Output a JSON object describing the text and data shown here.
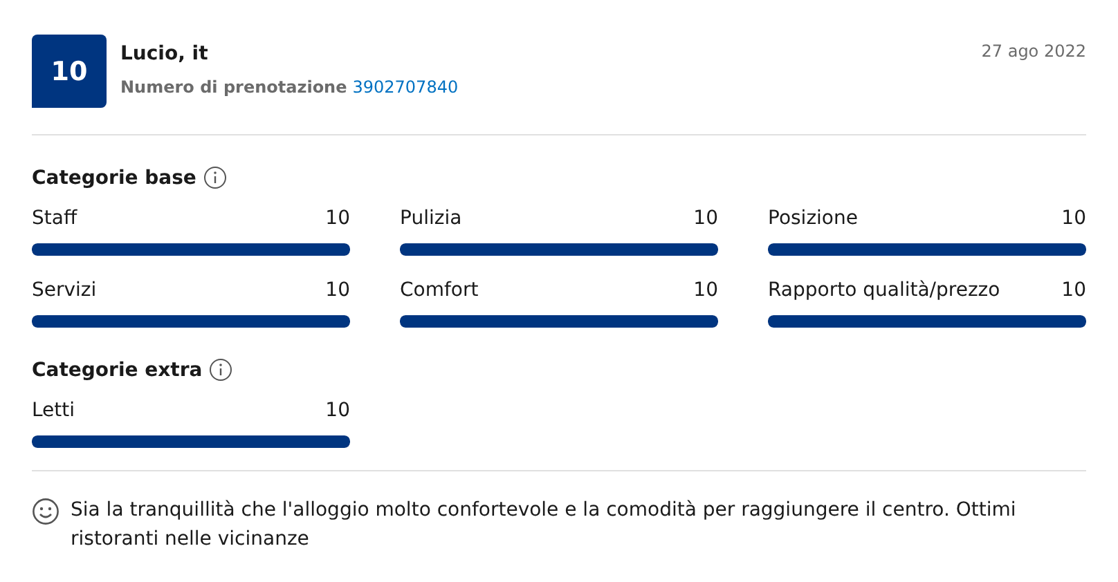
{
  "review": {
    "score": "10",
    "author": "Lucio, it",
    "booking_label": "Numero di prenotazione",
    "booking_number": "3902707840",
    "date": "27 ago 2022"
  },
  "sections": [
    {
      "title": "Categorie base",
      "categories": [
        {
          "name": "Staff",
          "value": "10",
          "level": 1
        },
        {
          "name": "Pulizia",
          "value": "10",
          "level": 1
        },
        {
          "name": "Posizione",
          "value": "10",
          "level": 1
        },
        {
          "name": "Servizi",
          "value": "10",
          "level": 1
        },
        {
          "name": "Comfort",
          "value": "10",
          "level": 1
        },
        {
          "name": "Rapporto qualità/prezzo",
          "value": "10",
          "level": 1
        }
      ]
    },
    {
      "title": "Categorie extra",
      "categories": [
        {
          "name": "Letti",
          "value": "10",
          "level": 1
        }
      ]
    }
  ],
  "comment": {
    "text": "Sia la tranquillità che l'alloggio molto confortevole e la comodità per raggiungere il centro. Ottimi ristoranti nelle vicinanze"
  }
}
